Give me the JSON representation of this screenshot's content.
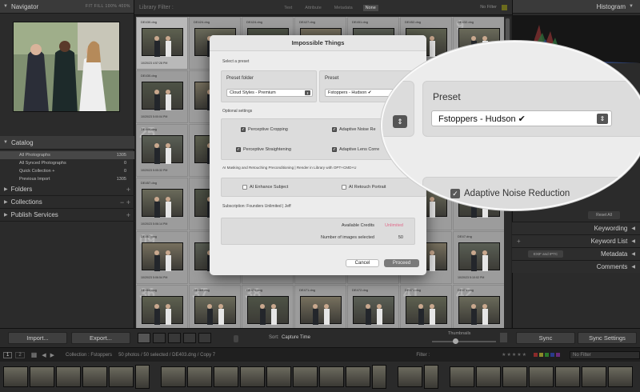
{
  "navigator": {
    "title": "Navigator",
    "zoom": "FIT  FILL  100%  400%"
  },
  "catalog": {
    "title": "Catalog",
    "items": [
      {
        "label": "All Photographs",
        "count": "1305"
      },
      {
        "label": "All Synced Photographs",
        "count": "0"
      },
      {
        "label": "Quick Collection +",
        "count": "0"
      },
      {
        "label": "Previous Import",
        "count": "1305"
      }
    ]
  },
  "left_sections": [
    "Folders",
    "Collections",
    "Publish Services"
  ],
  "left_buttons": {
    "import": "Import...",
    "export": "Export..."
  },
  "filter_bar": {
    "title": "Library Filter :",
    "options": [
      "Text",
      "Attribute",
      "Metadata",
      "None"
    ],
    "active": "None",
    "no_filter": "No Filter"
  },
  "grid_cells": [
    {
      "n": "",
      "fn": "DE430.dng",
      "dt": "10/20/23 4:57:28 PM"
    },
    {
      "n": "",
      "fn": "DE424.dng",
      "dt": ""
    },
    {
      "n": "",
      "fn": "DE424.dng",
      "dt": ""
    },
    {
      "n": "",
      "fn": "DE427.dng",
      "dt": ""
    },
    {
      "n": "",
      "fn": "DE451.dng",
      "dt": ""
    },
    {
      "n": "",
      "fn": "DE452.dng",
      "dt": ""
    },
    {
      "n": "9",
      "fn": "DE432.dng",
      "dt": ""
    },
    {
      "n": "",
      "fn": "DE430.dng",
      "dt": "10/20/23 5:00:04 PM"
    },
    {
      "n": "",
      "fn": "",
      "dt": ""
    },
    {
      "n": "",
      "fn": "",
      "dt": ""
    },
    {
      "n": "",
      "fn": "",
      "dt": ""
    },
    {
      "n": "",
      "fn": "",
      "dt": ""
    },
    {
      "n": "",
      "fn": "",
      "dt": ""
    },
    {
      "n": "",
      "fn": "",
      "dt": ""
    },
    {
      "n": "25",
      "fn": "DE446.dng",
      "dt": "10/20/23 5:05:32 PM"
    },
    {
      "n": "",
      "fn": "",
      "dt": ""
    },
    {
      "n": "",
      "fn": "",
      "dt": ""
    },
    {
      "n": "",
      "fn": "",
      "dt": ""
    },
    {
      "n": "",
      "fn": "",
      "dt": ""
    },
    {
      "n": "",
      "fn": "",
      "dt": ""
    },
    {
      "n": "",
      "fn": "",
      "dt": ""
    },
    {
      "n": "",
      "fn": "DE457.dng",
      "dt": "10/20/23 5:06:14 PM"
    },
    {
      "n": "",
      "fn": "",
      "dt": ""
    },
    {
      "n": "",
      "fn": "",
      "dt": ""
    },
    {
      "n": "",
      "fn": "",
      "dt": ""
    },
    {
      "n": "",
      "fn": "",
      "dt": ""
    },
    {
      "n": "",
      "fn": "",
      "dt": ""
    },
    {
      "n": "",
      "fn": "",
      "dt": ""
    },
    {
      "n": "09",
      "fn": "DE467.dng",
      "dt": "10/20/23 5:06:54 PM"
    },
    {
      "n": "",
      "fn": "",
      "dt": ""
    },
    {
      "n": "",
      "fn": "",
      "dt": ""
    },
    {
      "n": "",
      "fn": "",
      "dt": ""
    },
    {
      "n": "",
      "fn": "",
      "dt": ""
    },
    {
      "n": "",
      "fn": "",
      "dt": ""
    },
    {
      "n": "",
      "fn": "DE47.dng",
      "dt": "10/20/23 5:10:02 PM"
    },
    {
      "n": "36",
      "fn": "DE468.dng",
      "dt": "10/20/23 5:16:12 PM"
    },
    {
      "n": "37",
      "fn": "DE469.dng",
      "dt": "10/20/23 5:16:33 PM"
    },
    {
      "n": "38",
      "fn": "DE470.dng",
      "dt": "10/20/23 5:17:01 PM"
    },
    {
      "n": "",
      "fn": "DE471.dng",
      "dt": "10/20/23 5:17:30 PM"
    },
    {
      "n": "",
      "fn": "DE472.dng",
      "dt": "10/20/23 5:17:34 PM"
    },
    {
      "n": "41",
      "fn": "DE473.dng",
      "dt": "10/20/23 5:18:00 PM"
    },
    {
      "n": "42",
      "fn": "DE474.dng",
      "dt": "10/20/23 5:18:20 PM"
    }
  ],
  "toolbar": {
    "sort_label": "Sort:",
    "sort_value": "Capture Time",
    "thumbnails": "Thumbnails"
  },
  "right_panel": {
    "histogram": "Histogram",
    "sections": [
      "Keywording",
      "Keyword List",
      "Metadata",
      "Comments"
    ],
    "exif_select": "EXIF and IPTC",
    "reset_all": "Reset All",
    "sync": "Sync",
    "sync_settings": "Sync Settings"
  },
  "statusbar": {
    "pages": [
      "1",
      "2"
    ],
    "collection": "Collection : Fstoppers",
    "counts": "50 photos / 50 selected / DE403.dng / Copy 7",
    "filter": "Filter :",
    "no_filter": "No Filter"
  },
  "dialog": {
    "title": "Impossible Things",
    "select_preset": "Select a preset",
    "preset_folder_label": "Preset folder",
    "preset_folder_value": "Cloud Styles - Premium",
    "preset_label": "Preset",
    "preset_value": "Fstoppers - Hudson ✔",
    "optional_settings": "Optional settings",
    "opts": [
      {
        "label": "Perceptive Cropping",
        "checked": true
      },
      {
        "label": "Adaptive Noise Re",
        "checked": true
      },
      {
        "label": "Perceptive Straightening",
        "checked": true
      },
      {
        "label": "Adaptive Lens Corre",
        "checked": true
      }
    ],
    "ai_label": "AI Masking and Retouching Preconditioning | Render in Library with OPT+CMD+U",
    "ai_opts": [
      {
        "label": "AI Enhance Subject",
        "checked": false
      },
      {
        "label": "AI Retouch Portrait",
        "checked": false
      }
    ],
    "subscription": "Subscription: Founders Unlimited | Jeff",
    "credits_label": "Available Credits",
    "credits_value": "Unlimited",
    "images_label": "Number of images selected",
    "images_value": "50",
    "cancel": "Cancel",
    "proceed": "Proceed"
  },
  "magnifier": {
    "preset_label": "Preset",
    "preset_value": "Fstoppers - Hudson ✔",
    "noise_label": "Adaptive Noise Reduction"
  },
  "colors": {
    "accent": "#e06a8a",
    "dialog_bg": "#ececec",
    "panel": "#2b2b2b"
  }
}
